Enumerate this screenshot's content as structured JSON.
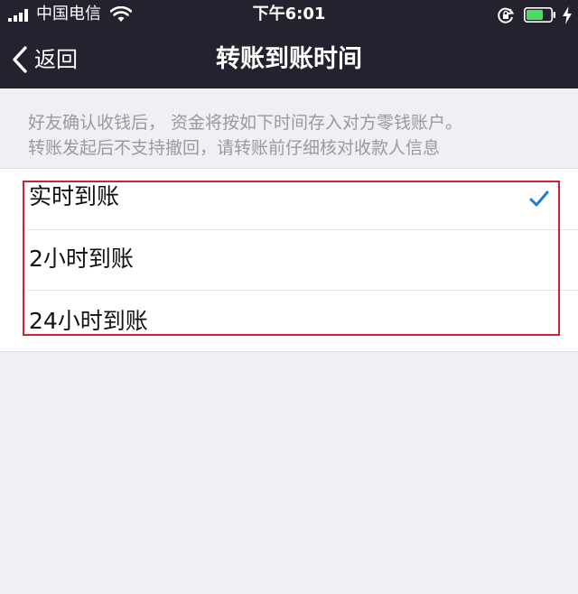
{
  "status_bar": {
    "carrier": "中国电信",
    "time": "下午6:01",
    "battery_color": "#4cd964"
  },
  "nav": {
    "back_label": "返回",
    "title": "转账到账时间"
  },
  "description": {
    "line1": "好友确认收钱后， 资金将按如下时间存入对方零钱账户。",
    "line2": "转账发起后不支持撤回，请转账前仔细核对收款人信息"
  },
  "options": [
    {
      "label": "实时到账",
      "selected": true
    },
    {
      "label": "2小时到账",
      "selected": false
    },
    {
      "label": "24小时到账",
      "selected": false
    }
  ],
  "colors": {
    "header_bg": "#23222e",
    "check": "#1a7fd4",
    "highlight_box": "#d81e2c"
  }
}
